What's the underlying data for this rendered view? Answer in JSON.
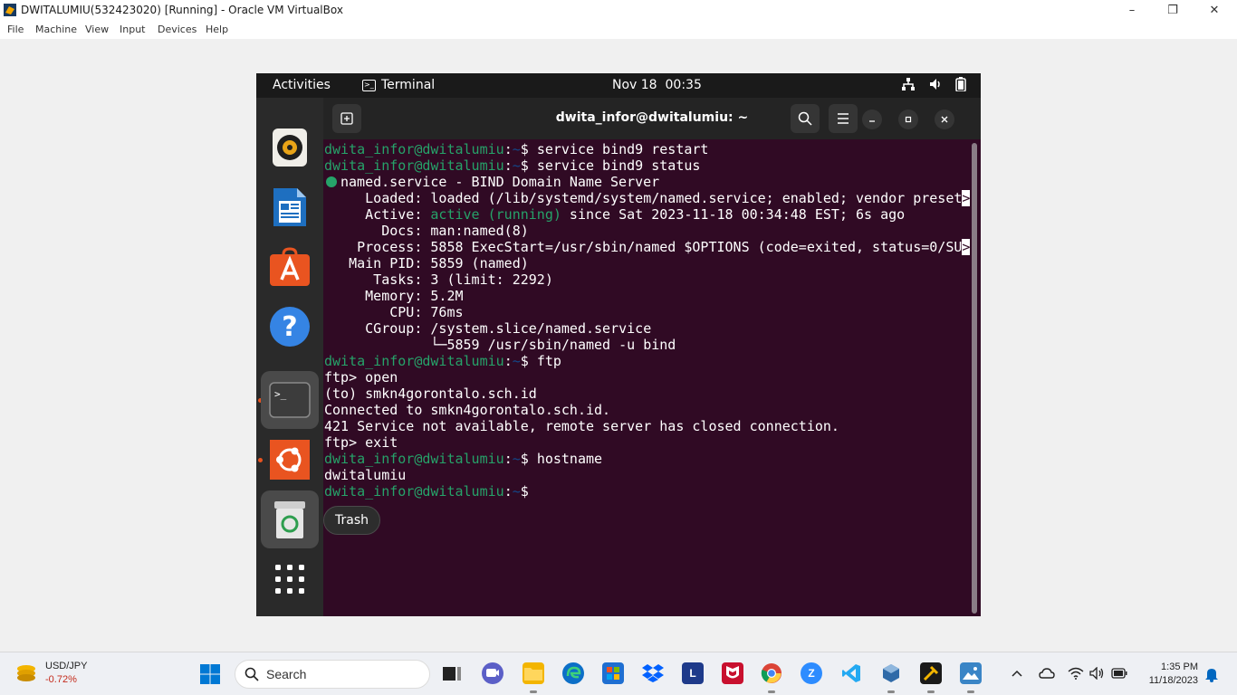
{
  "window": {
    "title": "DWITALUMIU(532423020) [Running] - Oracle VM VirtualBox",
    "minimize": "–",
    "restore": "❐",
    "close": "✕"
  },
  "menubar": [
    "File",
    "Machine",
    "View",
    "Input",
    "Devices",
    "Help"
  ],
  "guest": {
    "topbar": {
      "activities": "Activities",
      "app_name": "Terminal",
      "date": "Nov 18",
      "time": "00:35"
    },
    "terminal": {
      "title": "dwita_infor@dwitalumiu: ~",
      "prompt_user": "dwita_infor@dwitalumiu",
      "prompt_sep": ":",
      "prompt_path": "~",
      "prompt_sym": "$ ",
      "lines": {
        "cmd1": "service bind9 restart",
        "cmd2": "service bind9 status",
        "svc_name": "named.service - BIND Domain Name Server",
        "loaded": "     Loaded: loaded (/lib/systemd/system/named.service; enabled; vendor preset",
        "active_label": "     Active: ",
        "active_state": "active (running)",
        "active_rest": " since Sat 2023-11-18 00:34:48 EST; 6s ago",
        "docs": "       Docs: man:named(8)",
        "process": "    Process: 5858 ExecStart=/usr/sbin/named $OPTIONS (code=exited, status=0/SU",
        "main_pid": "   Main PID: 5859 (named)",
        "tasks": "      Tasks: 3 (limit: 2292)",
        "memory": "     Memory: 5.2M",
        "cpu": "        CPU: 76ms",
        "cgroup": "     CGroup: /system.slice/named.service",
        "cgroup_child": "             └─5859 /usr/sbin/named -u bind",
        "cmd3": "ftp",
        "ftp1": "ftp> open",
        "ftp2": "(to) smkn4gorontalo.sch.id",
        "ftp3": "Connected to smkn4gorontalo.sch.id.",
        "ftp4": "421 Service not available, remote server has closed connection.",
        "ftp5": "ftp> exit",
        "cmd4": "hostname",
        "out_hostname": "dwitalumiu",
        "trunc_marker": ">"
      }
    },
    "tooltip": "Trash"
  },
  "taskbar": {
    "ticker_name": "USD/JPY",
    "ticker_change": "-0.72%",
    "search_placeholder": "Search",
    "time": "1:35 PM",
    "date": "11/18/2023"
  }
}
